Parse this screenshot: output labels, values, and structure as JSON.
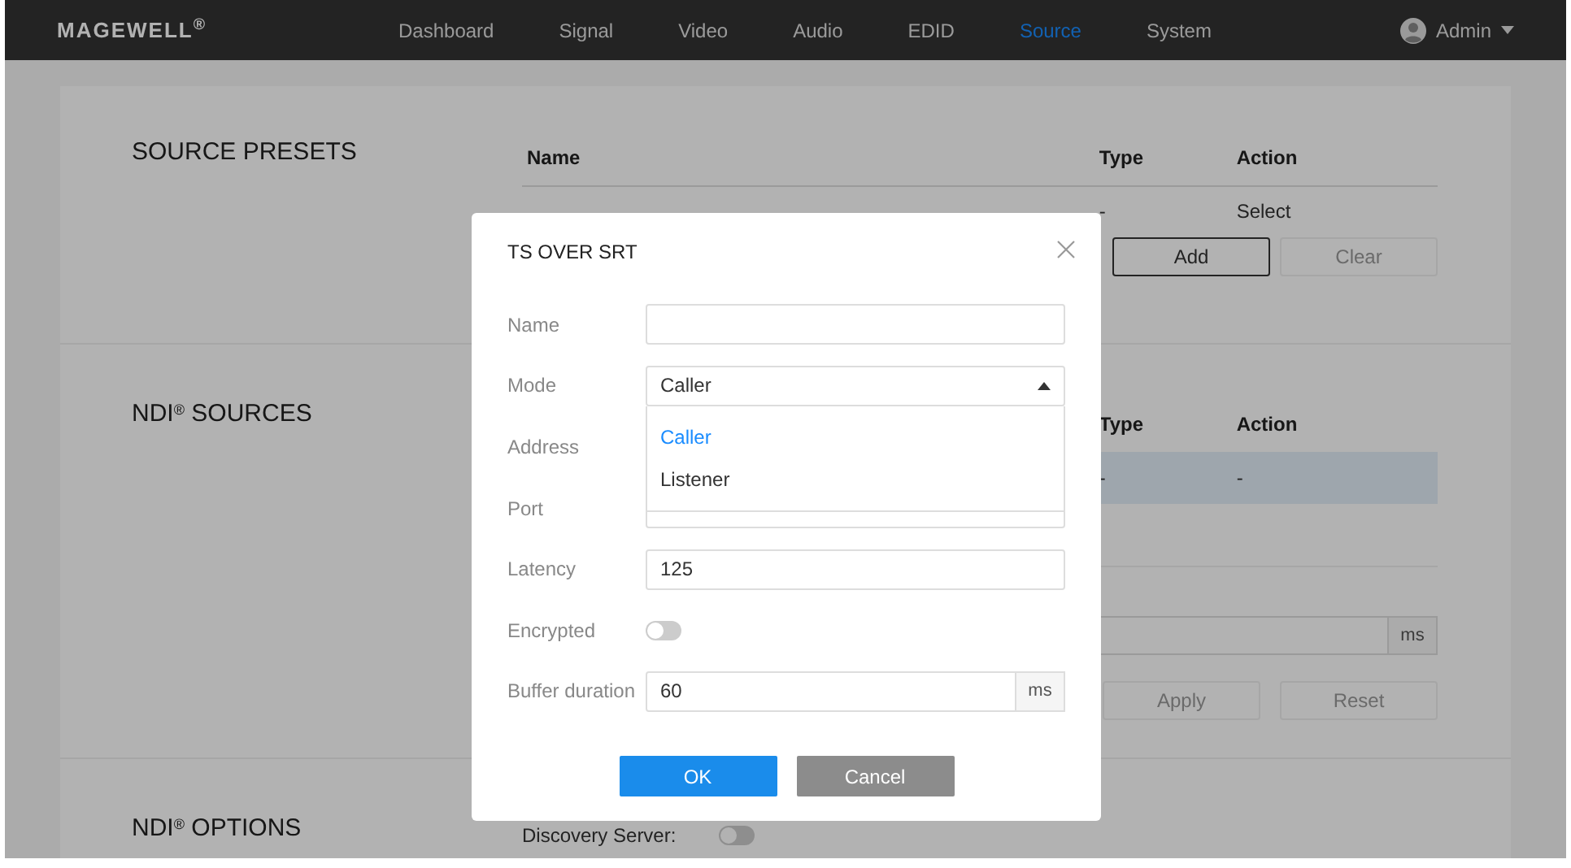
{
  "navbar": {
    "logo": "MAGEWELL$^{®}$",
    "items": [
      {
        "label": "Dashboard",
        "selected": false
      },
      {
        "label": "Signal",
        "selected": false
      },
      {
        "label": "Video",
        "selected": false
      },
      {
        "label": "Audio",
        "selected": false
      },
      {
        "label": "EDID",
        "selected": false
      },
      {
        "label": "Source",
        "selected": true
      },
      {
        "label": "System",
        "selected": false
      }
    ],
    "user": "Admin"
  },
  "source_presets": {
    "title": "SOURCE PRESETS",
    "columns": [
      "Name",
      "Type",
      "Action"
    ],
    "rows": [
      {
        "type": "-",
        "action": "Select"
      }
    ],
    "buttons": [
      {
        "label": "Add",
        "disabled": false
      },
      {
        "label": "Clear",
        "disabled": true
      }
    ]
  },
  "ndi_sources": {
    "title": "NDI$^{®}$ SOURCES",
    "columns": [
      "Type",
      "Action"
    ],
    "rows": [
      {
        "type": "-",
        "action": "-",
        "selected": true
      }
    ],
    "field_suffix": "ms",
    "buttons": [
      {
        "label": "Apply",
        "disabled": true
      },
      {
        "label": "Reset",
        "disabled": true
      }
    ]
  },
  "ndi_options": {
    "title": "NDI$^{®}$ OPTIONS",
    "discovery_server": {
      "label": "Discovery Server:",
      "on": false
    }
  },
  "dialog": {
    "title": "TS OVER SRT",
    "fields": [
      {
        "kind": "text",
        "label": "Name"
      },
      {
        "kind": "select",
        "label": "Mode",
        "value": "Caller",
        "expanded": true,
        "options": [
          {
            "label": "Caller",
            "selected": true
          },
          {
            "label": "Listener",
            "selected": false
          }
        ]
      },
      {
        "kind": "hidden",
        "label": "Address"
      },
      {
        "kind": "text",
        "label": "Port"
      },
      {
        "kind": "text",
        "label": "Latency",
        "value": "125"
      },
      {
        "kind": "toggle",
        "label": "Encrypted",
        "on": false
      },
      {
        "kind": "suffix",
        "label": "Buffer duration",
        "value": "60",
        "suffix": "ms"
      }
    ],
    "buttons": [
      {
        "kind": "primary",
        "label": "OK"
      },
      {
        "kind": "secondary",
        "label": "Cancel"
      }
    ]
  }
}
